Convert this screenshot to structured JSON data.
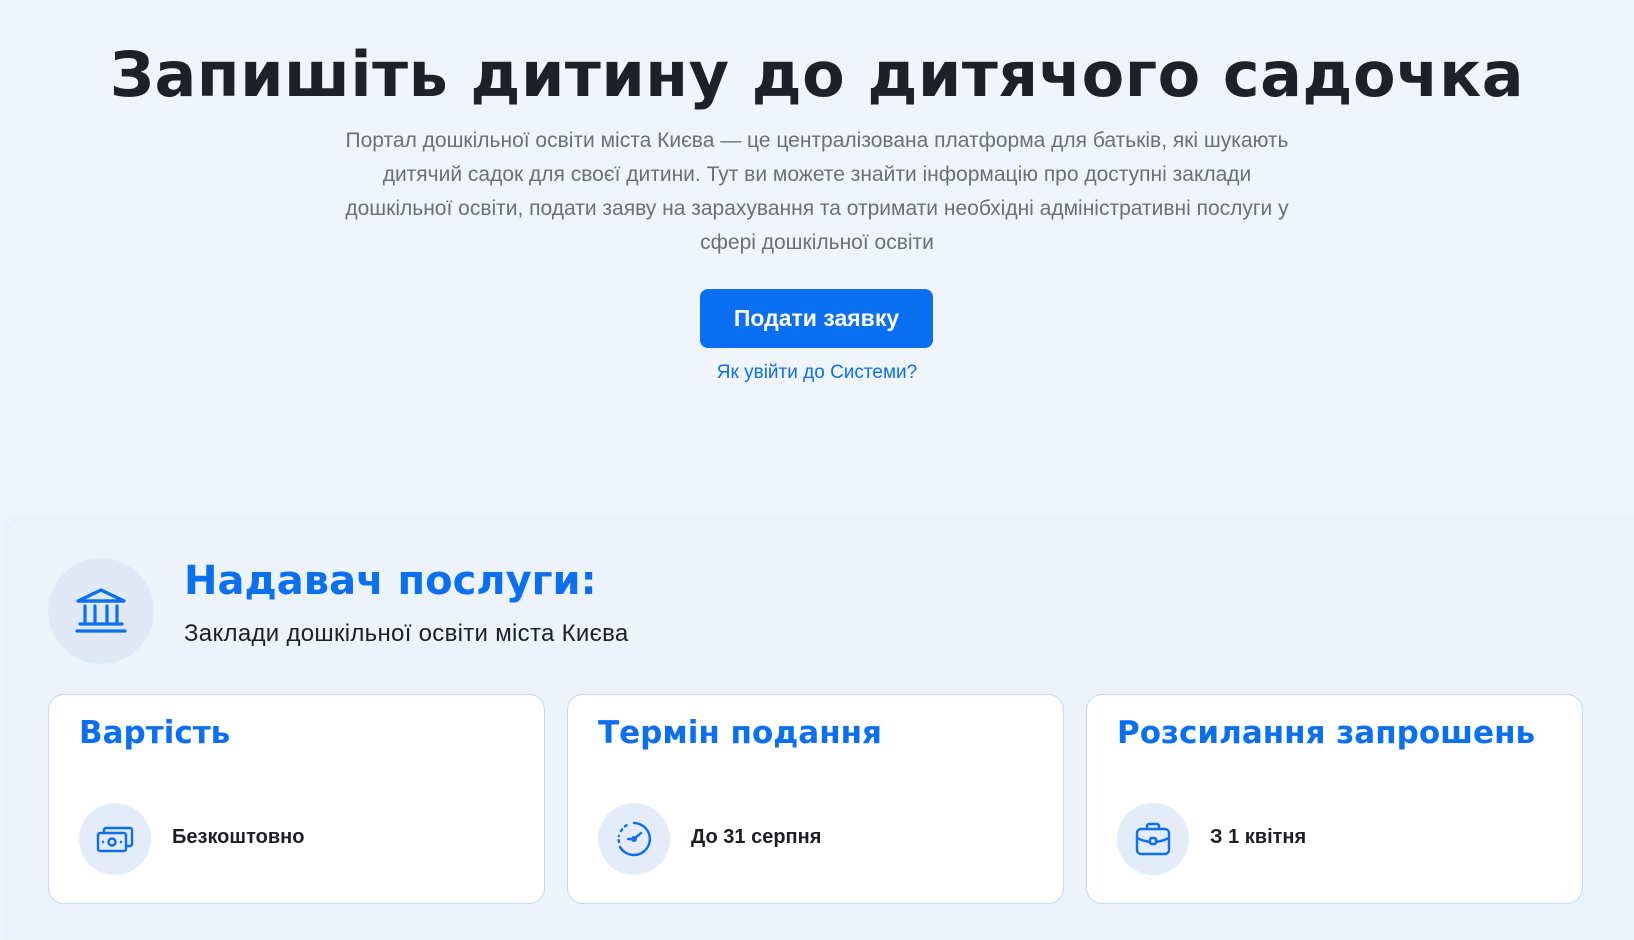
{
  "hero": {
    "title": "Запишіть дитину до дитячого садочка",
    "description": "Портал дошкільної освіти міста Києва — це централізована платформа для батьків, які шукають дитячий садок для своєї дитини. Тут ви можете знайти інформацію про доступні заклади дошкільної освіти, подати заяву на зарахування та отримати необхідні адміністративні послуги у сфері дошкільної освіти",
    "apply_label": "Подати заявку",
    "login_link": "Як увійти до Системи?"
  },
  "provider": {
    "title": "Надавач послуги:",
    "name": "Заклади дошкільної освіти міста Києва",
    "icon": "government-building-icon"
  },
  "cards": [
    {
      "title": "Вартість",
      "value": "Безкоштовно",
      "icon": "money-icon"
    },
    {
      "title": "Термін подання",
      "value": "До 31 серпня",
      "icon": "clock-icon"
    },
    {
      "title": "Розсилання запрошень",
      "value": "З 1 квітня",
      "icon": "briefcase-icon"
    }
  ],
  "colors": {
    "accent": "#0b6ff2",
    "background": "#f0f5fc",
    "card_border": "#c5d8f0"
  }
}
